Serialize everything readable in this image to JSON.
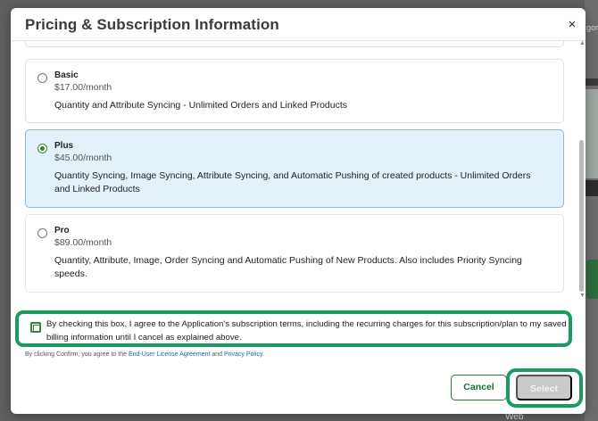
{
  "background": {
    "side_text": "gor",
    "footer_text": "Web"
  },
  "modal": {
    "title": "Pricing & Subscription Information",
    "close_symbol": "×"
  },
  "plans": [
    {
      "name": "Basic",
      "price": "$17.00/month",
      "description": "Quantity and Attribute Syncing - Unlimited Orders and Linked Products",
      "selected": false
    },
    {
      "name": "Plus",
      "price": "$45.00/month",
      "description": "Quantity Syncing, Image Syncing, Attribute Syncing, and Automatic Pushing of created products - Unlimited Orders and Linked Products",
      "selected": true
    },
    {
      "name": "Pro",
      "price": "$89.00/month",
      "description": "Quantity, Attribute, Image, Order Syncing and Automatic Pushing of New Products. Also includes Priority Syncing speeds.",
      "selected": false
    }
  ],
  "consent": {
    "text": "By checking this box, I agree to the Application's subscription terms, including the recurring charges for this subscription/plan to my saved billing information until I cancel as explained above.",
    "checked": false
  },
  "legal": {
    "prefix": "By clicking Confirm, you agree to the ",
    "eula_link": "End-User License Agreement",
    "and": " and ",
    "privacy_link": "Privacy Policy",
    "suffix": "."
  },
  "buttons": {
    "cancel": "Cancel",
    "select": "Select"
  },
  "colors": {
    "highlight_green": "#1a9c61",
    "selected_card_bg": "#e3f1fb",
    "select_disabled_bg": "#c9c9c9"
  },
  "icons": {
    "close": "close-icon",
    "scroll_up": "scroll-up-arrow-icon",
    "scroll_down": "scroll-down-arrow-icon"
  }
}
